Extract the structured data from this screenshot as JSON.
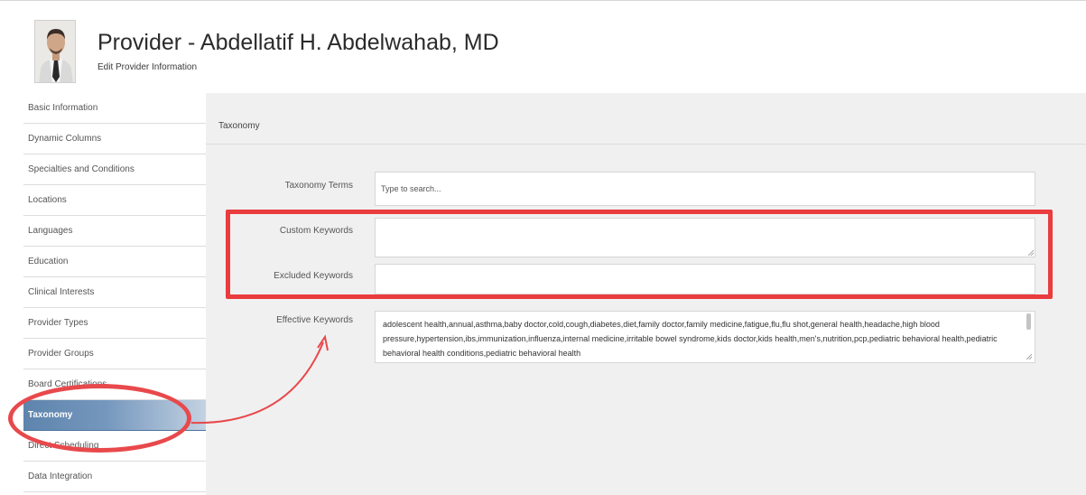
{
  "header": {
    "title": "Provider - Abdellatif H. Abdelwahab, MD",
    "subtitle": "Edit Provider Information"
  },
  "sidebar": {
    "items": [
      {
        "label": "Basic Information",
        "active": false
      },
      {
        "label": "Dynamic Columns",
        "active": false
      },
      {
        "label": "Specialties and Conditions",
        "active": false
      },
      {
        "label": "Locations",
        "active": false
      },
      {
        "label": "Languages",
        "active": false
      },
      {
        "label": "Education",
        "active": false
      },
      {
        "label": "Clinical Interests",
        "active": false
      },
      {
        "label": "Provider Types",
        "active": false
      },
      {
        "label": "Provider Groups",
        "active": false
      },
      {
        "label": "Board Certifications",
        "active": false
      },
      {
        "label": "Taxonomy",
        "active": true
      },
      {
        "label": "Direct Scheduling",
        "active": false
      },
      {
        "label": "Data Integration",
        "active": false
      }
    ]
  },
  "main": {
    "section_title": "Taxonomy",
    "taxonomy_terms": {
      "label": "Taxonomy Terms",
      "placeholder": "Type to search...",
      "value": ""
    },
    "custom_keywords": {
      "label": "Custom Keywords",
      "value": ""
    },
    "excluded_keywords": {
      "label": "Excluded Keywords",
      "value": ""
    },
    "effective_keywords": {
      "label": "Effective Keywords",
      "value": "adolescent health,annual,asthma,baby doctor,cold,cough,diabetes,diet,family doctor,family medicine,fatigue,flu,flu shot,general health,headache,high blood pressure,hypertension,ibs,immunization,influenza,internal medicine,irritable bowel syndrome,kids doctor,kids health,men's,nutrition,pcp,pediatric behavioral health,pediatric behavioral health conditions,pediatric behavioral health"
    }
  },
  "colors": {
    "annotation_red": "#ea3c3e",
    "active_item_blue": "#5e84ad",
    "panel_gray": "#f0f0f0"
  }
}
